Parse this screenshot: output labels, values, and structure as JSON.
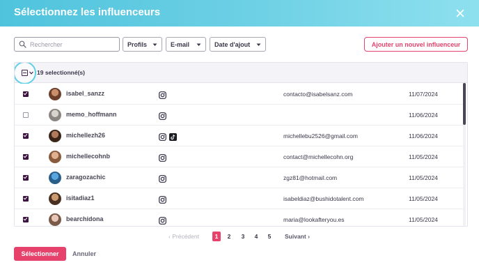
{
  "modal": {
    "title": "Sélectionnez les influenceurs"
  },
  "toolbar": {
    "search_placeholder": "Rechercher",
    "search_value": "",
    "filters": [
      {
        "label": "Profils"
      },
      {
        "label": "E-mail"
      },
      {
        "label": "Date d'ajout"
      }
    ],
    "add_button": "Ajouter un nouvel influenceur"
  },
  "table": {
    "selected_count": "19 selectionné(s)",
    "rows": [
      {
        "checked": true,
        "username": "isabel_sanzz",
        "networks": [
          "instagram"
        ],
        "email": "contacto@isabelsanz.com",
        "date": "11/07/2024"
      },
      {
        "checked": false,
        "username": "memo_hoffmann",
        "networks": [
          "instagram"
        ],
        "email": "",
        "date": "11/06/2024"
      },
      {
        "checked": true,
        "username": "michellezh26",
        "networks": [
          "instagram",
          "tiktok"
        ],
        "email": "michellebu2526@gmail.com",
        "date": "11/06/2024"
      },
      {
        "checked": true,
        "username": "michellecohnb",
        "networks": [
          "instagram"
        ],
        "email": "contact@michellecohn.org",
        "date": "11/05/2024"
      },
      {
        "checked": true,
        "username": "zaragozachic",
        "networks": [
          "instagram"
        ],
        "email": "zgz81@hotmail.com",
        "date": "11/05/2024"
      },
      {
        "checked": true,
        "username": "isitadiaz1",
        "networks": [
          "instagram"
        ],
        "email": "isabeldiaz@bushidotalent.com",
        "date": "11/05/2024"
      },
      {
        "checked": true,
        "username": "bearchidona",
        "networks": [
          "instagram"
        ],
        "email": "maria@lookafteryou.es",
        "date": "11/05/2024"
      }
    ]
  },
  "pagination": {
    "prev": "Précédent",
    "next": "Suivant",
    "pages": [
      "1",
      "2",
      "3",
      "4",
      "5"
    ],
    "current": "1"
  },
  "footer": {
    "select_button": "Sélectionner",
    "cancel_button": "Annuler"
  },
  "colors": {
    "accent": "#e6426b",
    "header_gradient_start": "#4fc3dd",
    "header_gradient_end": "#8ee0ee",
    "checkbox": "#3d1340"
  }
}
